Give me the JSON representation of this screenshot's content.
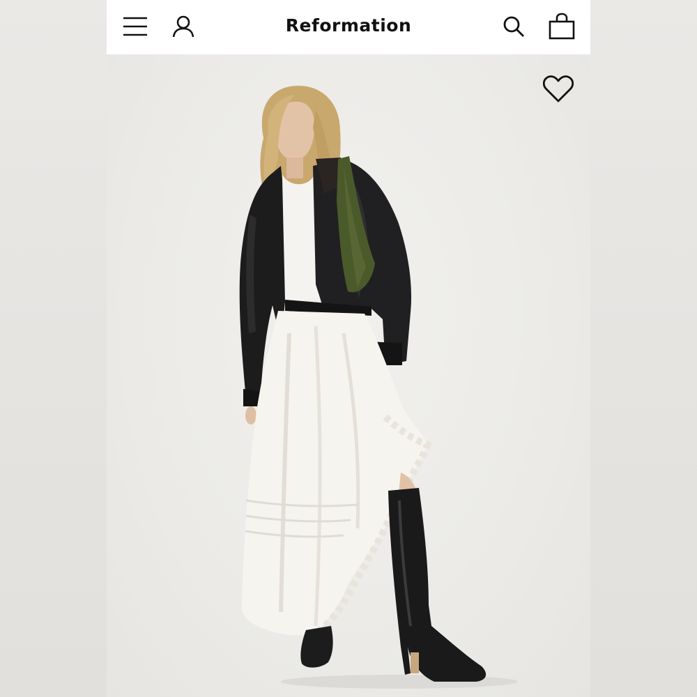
{
  "header": {
    "brand": "Reformation",
    "icons": {
      "menu": "hamburger-menu-icon",
      "account": "user-icon",
      "search": "search-icon",
      "bag": "shopping-bag-icon"
    }
  },
  "product": {
    "image": "model-in-black-leather-jacket-white-tank-white-eyelet-maxi-skirt-black-knee-boots",
    "wishlist_icon": "heart-icon"
  },
  "colors": {
    "header_bg": "#ffffff",
    "icon": "#111111",
    "image_bg": "#ecebe8"
  }
}
